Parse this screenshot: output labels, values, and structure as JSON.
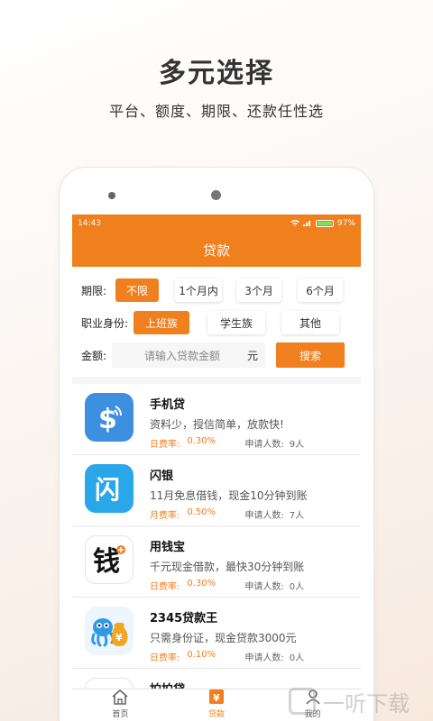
{
  "promo": {
    "title": "多元选择",
    "subtitle": "平台、额度、期限、还款任性选"
  },
  "status_bar": {
    "time": "14:43",
    "battery": "97%"
  },
  "app_bar": {
    "title": "贷款"
  },
  "filters": {
    "term_label": "期限:",
    "term_options": [
      "不限",
      "1个月内",
      "3个月",
      "6个月"
    ],
    "identity_label": "职业身份:",
    "identity_options": [
      "上班族",
      "学生族",
      "其他"
    ],
    "amount_label": "金额:",
    "amount_placeholder": "请输入贷款金额",
    "amount_unit": "元",
    "search_label": "搜索"
  },
  "loans": [
    {
      "name": "手机贷",
      "desc": "资料少，授信简单，放款快!",
      "rate_label": "日费率:",
      "rate": "0.30%",
      "apply_label": "申请人数:",
      "apply_count": "9人",
      "logo": "dollar-signal-icon"
    },
    {
      "name": "闪银",
      "desc": "11月免息借钱，现金10分钟到账",
      "rate_label": "月费率:",
      "rate": "0.50%",
      "apply_label": "申请人数:",
      "apply_count": "7人",
      "logo": "shan-char-icon"
    },
    {
      "name": "用钱宝",
      "desc": "千元现金借款，最快30分钟到账",
      "rate_label": "日费率:",
      "rate": "0.30%",
      "apply_label": "申请人数:",
      "apply_count": "0人",
      "logo": "qian-char-icon"
    },
    {
      "name": "2345贷款王",
      "desc": "只需身份证，现金贷款3000元",
      "rate_label": "日费率:",
      "rate": "0.10%",
      "apply_label": "申请人数:",
      "apply_count": "0人",
      "logo": "octopus-moneybag-icon"
    },
    {
      "name": "拍拍贷",
      "desc": "",
      "rate_label": "",
      "rate": "",
      "apply_label": "",
      "apply_count": "",
      "logo": "paipai-icon"
    }
  ],
  "tabs": [
    {
      "label": "首页",
      "icon": "home-icon"
    },
    {
      "label": "贷款",
      "icon": "yen-icon"
    },
    {
      "label": "我的",
      "icon": "user-icon"
    }
  ],
  "watermark": {
    "text": "一听下载"
  },
  "colors": {
    "accent": "#f07f1d"
  }
}
